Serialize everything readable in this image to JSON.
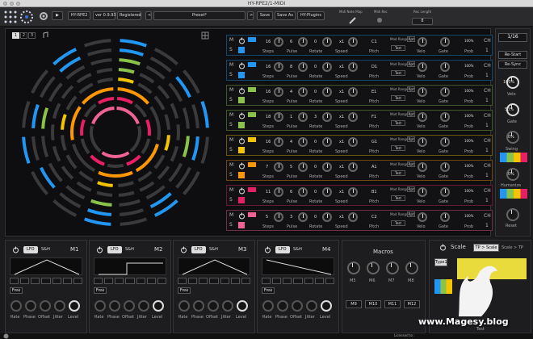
{
  "window_title": "HY-RPE2/1-MIDI",
  "toolbar": {
    "plugin": "HY-RPE2",
    "version": "ver 0.9.93",
    "registered": "Registered",
    "preset": "Preset*",
    "save": "Save",
    "save_as": "Save As",
    "hy_plugins": "HY-Plugins",
    "midi_note_map": "Midi Note Map",
    "midi_rec": "Midi Rec",
    "rec_length": "Rec Length",
    "rec_length_val": "8"
  },
  "page_tabs": [
    "1",
    "2",
    "3"
  ],
  "tracks": [
    {
      "ch": "CH",
      "ch_num": "1",
      "steps": "16",
      "pulse": "6",
      "rotate": "0",
      "speed": "x1",
      "pitch": "C1",
      "gate": "100%",
      "prob": "100%",
      "color": "#2196f3"
    },
    {
      "ch": "CH",
      "ch_num": "1",
      "steps": "16",
      "pulse": "8",
      "rotate": "0",
      "speed": "x1",
      "pitch": "D1",
      "gate": "100%",
      "prob": "100%",
      "color": "#2196f3"
    },
    {
      "ch": "CH",
      "ch_num": "1",
      "steps": "16",
      "pulse": "4",
      "rotate": "0",
      "speed": "x1",
      "pitch": "E1",
      "gate": "100%",
      "prob": "100%",
      "color": "#8bc34a"
    },
    {
      "ch": "CH",
      "ch_num": "1",
      "steps": "18",
      "pulse": "1",
      "rotate": "3",
      "speed": "x1",
      "pitch": "F1",
      "gate": "100%",
      "prob": "100%",
      "color": "#8bc34a"
    },
    {
      "ch": "CH",
      "ch_num": "1",
      "steps": "16",
      "pulse": "4",
      "rotate": "0",
      "speed": "x1",
      "pitch": "G1",
      "gate": "100%",
      "prob": "100%",
      "color": "#f5c400"
    },
    {
      "ch": "CH",
      "ch_num": "1",
      "steps": "7",
      "pulse": "5",
      "rotate": "0",
      "speed": "x1",
      "pitch": "A1",
      "gate": "100%",
      "prob": "100%",
      "color": "#ff9800"
    },
    {
      "ch": "CH",
      "ch_num": "1",
      "steps": "11",
      "pulse": "6",
      "rotate": "0",
      "speed": "x1",
      "pitch": "B1",
      "gate": "100%",
      "prob": "100%",
      "color": "#e91e63"
    },
    {
      "ch": "CH",
      "ch_num": "1",
      "steps": "5",
      "pulse": "3",
      "rotate": "0",
      "speed": "x1",
      "pitch": "C2",
      "gate": "100%",
      "prob": "100%",
      "color": "#f06292"
    }
  ],
  "track_captions": {
    "steps": "Steps",
    "pulse": "Pulse",
    "rotate": "Rotate",
    "speed": "Speed",
    "pitch": "Pitch",
    "velo": "Velo",
    "gate": "Gate",
    "prob": "Prob",
    "mod_range": "Mod Range",
    "test": "Test",
    "rpt": "Rpt"
  },
  "side": {
    "division": "1/16",
    "restart": "Re-Start",
    "resync": "Re-Sync",
    "velo_val": "100%",
    "velo": "Velo",
    "gate_val": "50%",
    "gate": "Gate",
    "swing_val": "0%",
    "swing": "Swing",
    "humanize_val": "0%",
    "humanize": "Humanize",
    "reset": "Reset"
  },
  "lfos": [
    {
      "name": "M1",
      "lfo": "LFO",
      "sh": "S&H",
      "free": "Free"
    },
    {
      "name": "M2",
      "lfo": "LFO",
      "sh": "S&H",
      "free": "Free"
    },
    {
      "name": "M3",
      "lfo": "LFO",
      "sh": "S&H",
      "free": "Free"
    },
    {
      "name": "M4",
      "lfo": "LFO",
      "sh": "S&H",
      "free": "Free"
    }
  ],
  "lfo_knobs": [
    "Rate",
    "Phase",
    "Offset",
    "Jitter",
    "Level"
  ],
  "macros": {
    "title": "Macros",
    "knobs": [
      "M5",
      "M6",
      "M7",
      "M8"
    ],
    "buttons": [
      "M9",
      "M10",
      "M11",
      "M12"
    ]
  },
  "scale": {
    "title": "Scale",
    "tp_scale": "TP > Scale",
    "scale_tp": "Scale > TP",
    "type": "Type1",
    "test": "Test"
  },
  "footer": {
    "licensed": "Licensed to :",
    "watermark": "www.Magesy.blog"
  }
}
